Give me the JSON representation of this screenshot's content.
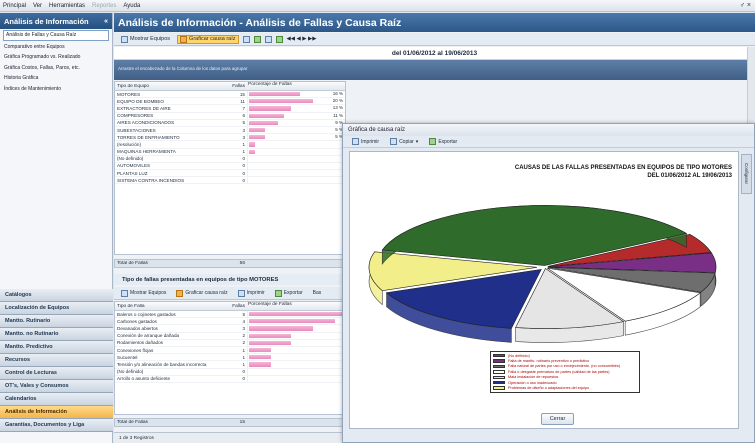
{
  "menubar": {
    "items": [
      "Principal",
      "Ver",
      "Herramientas",
      "Reportes",
      "Ayuda"
    ],
    "pin": "♂ ×"
  },
  "sidebar": {
    "title": "Análisis de Información",
    "collapse": "«",
    "items": [
      "Análisis de Fallas y Causa Raíz",
      "Comparativo entre Equipos",
      "Gráfica Programado vs. Realizado",
      "Gráfica Costos, Fallas, Paros, etc.",
      "Historia Gráfica",
      "Índices de Mantenimiento"
    ],
    "modules": [
      "Catálogos",
      "Localización de Equipos",
      "Mantto. Rutinario",
      "Mantto. no Rutinario",
      "Mantto. Predictivo",
      "Recursos",
      "Control de Lecturas",
      "OT's, Vales y Consumos",
      "Calendarios",
      "Análisis de Información",
      "Garantías, Documentos y Liga"
    ]
  },
  "main": {
    "title": "Análisis de Información - Análisis de Fallas y Causa Raíz",
    "toolbar": {
      "show_equipment": "Mostrar Equipos",
      "graph_causes": "Graficar causa raíz"
    },
    "period": "del 01/06/2012 al 19/06/2013",
    "info": "Arrastre el encabezado de la Columna de los datos para agrupar",
    "grid1": {
      "headers": [
        "Tipo de Equipo",
        "Fallas",
        "Porcentaje de Fallas"
      ],
      "rows": [
        {
          "name": "MOTORES",
          "fails": "15",
          "pct": "16 %",
          "ratio": 0.16
        },
        {
          "name": "EQUIPO DE BOMBEO",
          "fails": "11",
          "pct": "20 %",
          "ratio": 0.2
        },
        {
          "name": "EXTRACTORES DE AIRE",
          "fails": "7",
          "pct": "13 %",
          "ratio": 0.13
        },
        {
          "name": "COMPRESORES",
          "fails": "6",
          "pct": "11 %",
          "ratio": 0.11
        },
        {
          "name": "AIRES ACONDICIONADOS",
          "fails": "5",
          "pct": "9 %",
          "ratio": 0.09
        },
        {
          "name": "SUBESTACIONES",
          "fails": "3",
          "pct": "5 %",
          "ratio": 0.05
        },
        {
          "name": "TORRES DE ENFRIAMIENTO",
          "fails": "3",
          "pct": "5 %",
          "ratio": 0.05
        },
        {
          "name": "(resolución)",
          "fails": "1",
          "pct": "",
          "ratio": 0.02
        },
        {
          "name": "MAQUINAS HERRAMIENTA",
          "fails": "1",
          "pct": "",
          "ratio": 0.02
        },
        {
          "name": "(No definido)",
          "fails": "0",
          "pct": "",
          "ratio": 0
        },
        {
          "name": "AUTOMOVILES",
          "fails": "0",
          "pct": "",
          "ratio": 0
        },
        {
          "name": "PLANTAS LUZ",
          "fails": "0",
          "pct": "",
          "ratio": 0
        },
        {
          "name": "SISTEMA CONTRA INCENDIOS",
          "fails": "0",
          "pct": "",
          "ratio": 0
        }
      ],
      "total_label": "Total de Fallas",
      "total_value": "56"
    },
    "sub_title": "Tipo de fallas presentadas en equipos de tipo MOTORES",
    "toolbar2": {
      "show_equipment": "Mostrar Equipos",
      "graph_causes": "Graficar causa raíz",
      "print": "Imprimir",
      "export": "Exportar",
      "extra": "Bas"
    },
    "grid2": {
      "headers": [
        "Tipo de Falla",
        "Fallas",
        "Porcentaje de Fallas"
      ],
      "rows": [
        {
          "name": "Baleros o cojinetes gastados",
          "fails": "5",
          "ratio": 0.33
        },
        {
          "name": "Carbones gastados",
          "fails": "4",
          "ratio": 0.27
        },
        {
          "name": "Devanados abiertos",
          "fails": "3",
          "ratio": 0.2
        },
        {
          "name": "Conexión de arranque dañada",
          "fails": "2",
          "ratio": 0.13
        },
        {
          "name": "Rodamientos dañados",
          "fails": "2",
          "ratio": 0.13
        },
        {
          "name": "Conexiones flojas",
          "fails": "1",
          "ratio": 0.07
        },
        {
          "name": "Sucuentel",
          "fails": "1",
          "ratio": 0.07
        },
        {
          "name": "Tensión y/o alineación de bandas incorrecta",
          "fails": "1",
          "ratio": 0.07
        },
        {
          "name": "(No definido)",
          "fails": "0",
          "ratio": 0
        },
        {
          "name": "Arrollo o asunto deficiente",
          "fails": "0",
          "ratio": 0
        }
      ],
      "total_label": "Total de Fallas",
      "total_value": "15"
    },
    "status": "1 de 3 Registros"
  },
  "dialog": {
    "title": "Gráfica de causa raíz",
    "print": "Imprimir",
    "copy": "Copiar",
    "export": "Exportar",
    "side_tab": "Configurar",
    "close": "Cerrar",
    "chart_title": "CAUSAS DE LAS FALLAS PRESENTADAS EN EQUIPOS DE TIPO MOTORES",
    "chart_subtitle": "DEL 01/06/2012 AL 19/06/2013"
  },
  "chart_data": {
    "type": "pie",
    "title": "CAUSAS DE LAS FALLAS PRESENTADAS EN EQUIPOS DE TIPO MOTORES",
    "subtitle": "DEL 01/06/2012 AL 19/06/2013",
    "series": [
      {
        "name": "(No definido)",
        "value": 1,
        "color": "#b52a2a"
      },
      {
        "name": "Falta de mantto. rutinario preventivo o predictivo",
        "value": 1,
        "color": "#7a2f86"
      },
      {
        "name": "Falla natural de partes por uso o envejecimiento. (no consumibles)",
        "value": 1,
        "color": "#6e6e6e"
      },
      {
        "name": "Falla o desgaste prematuro de partes (calidad de las partes)",
        "value": 2,
        "color": "#ffffff"
      },
      {
        "name": "Mala instalación de repuestos",
        "value": 2,
        "color": "#e5e5e5"
      },
      {
        "name": "Operación o uso inadecuado",
        "value": 3,
        "color": "#1f2f8a"
      },
      {
        "name": "Problemas de diseño o adaptaciones del equipo",
        "value": 2,
        "color": "#f2ef8a"
      },
      {
        "name": "Otros",
        "value": 7,
        "color": "#2f6b2a"
      }
    ],
    "legend_position": "bottom"
  }
}
